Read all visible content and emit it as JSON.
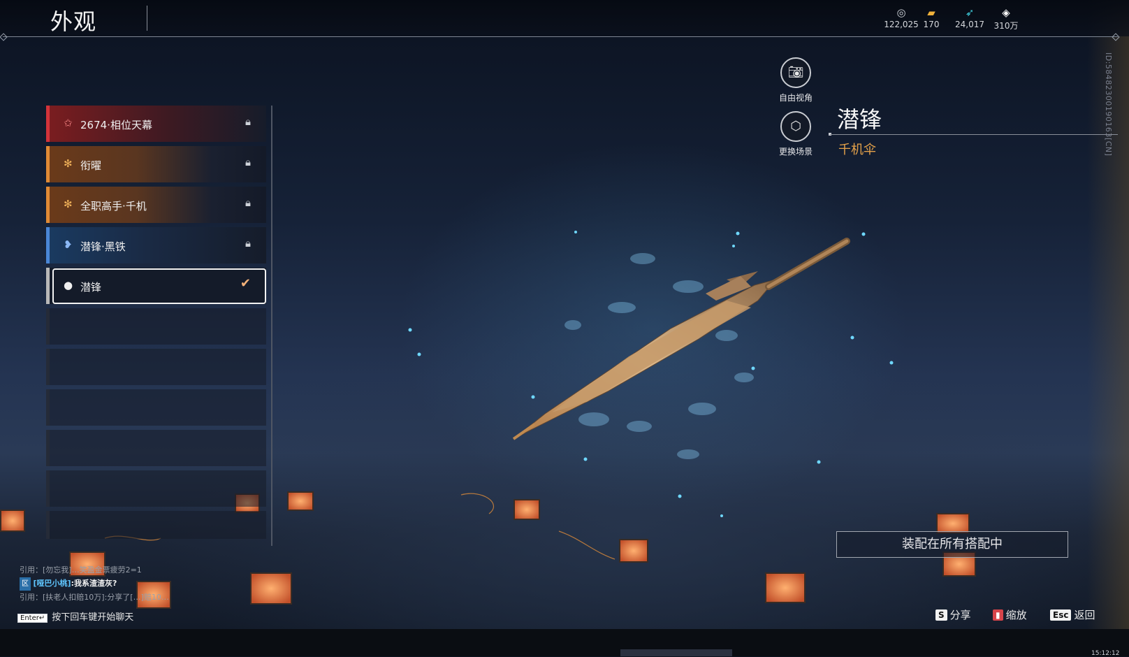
{
  "header": {
    "title": "外观",
    "currencies": [
      {
        "icon": "coin-stack-icon",
        "value": "122,025"
      },
      {
        "icon": "gold-ticket-icon",
        "value": "170"
      },
      {
        "icon": "feather-icon",
        "value": "24,017"
      },
      {
        "icon": "diamond-icon",
        "value": "310万"
      }
    ]
  },
  "side_id": "ID:584823001901​63[CN]",
  "skins": [
    {
      "label": "2674·相位天幕",
      "rarity": "red",
      "icon": "star-gem-icon",
      "locked": true
    },
    {
      "label": "衔曜",
      "rarity": "orange",
      "icon": "orange-gem-icon",
      "locked": true
    },
    {
      "label": "全职高手·千机",
      "rarity": "orange",
      "icon": "orange-gem-icon",
      "locked": true
    },
    {
      "label": "潜锋·黑铁",
      "rarity": "blue",
      "icon": "blue-gem-icon",
      "locked": true
    },
    {
      "label": "潜锋",
      "rarity": "white",
      "icon": "white-gem-icon",
      "locked": false,
      "selected": true
    }
  ],
  "camera": {
    "free_view": "自由视角",
    "change_scene": "更换场景"
  },
  "detail": {
    "name": "潜锋",
    "type": "千机伞"
  },
  "equip_button": "装配在所有搭配中",
  "hints": [
    {
      "key": "S",
      "label": "分享"
    },
    {
      "key": "mouse",
      "label": "缩放"
    },
    {
      "key": "Esc",
      "label": "返回"
    }
  ],
  "chat": {
    "line1": "引用：[勿忘我]…笑盈金票疲劳2=1",
    "line2_badge": "区",
    "line2_user": "[哑巴小桃]",
    "line2_msg": ":我系渣渣灰?",
    "line3": "引用：[扶老人扣赔10万]:分享了[…]赔10…",
    "input_key": "Enter↵",
    "input_hint": "按下回车键开始聊天"
  },
  "taskbar": {
    "clock": "15:12:12"
  }
}
